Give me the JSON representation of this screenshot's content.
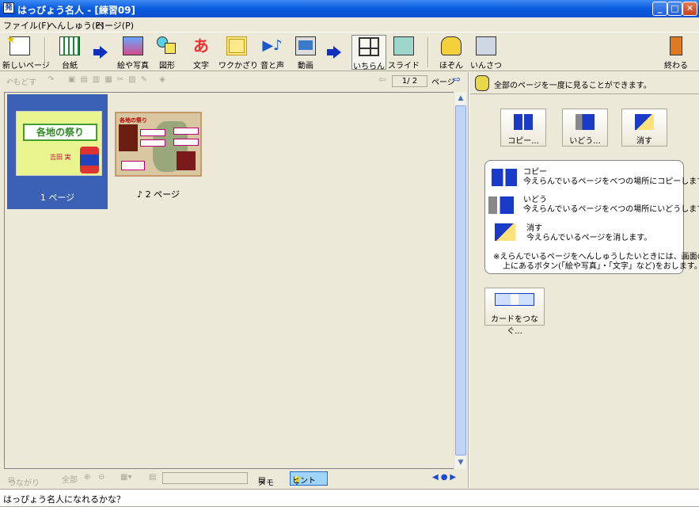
{
  "window": {
    "title": "はっぴょう名人 - [練習09]"
  },
  "menu": [
    "ファイル(F)",
    "へんしゅう(E)",
    "ページ(P)"
  ],
  "toolbar": {
    "new_page": "新しいページ",
    "base": "台紙",
    "picture": "絵や写真",
    "shape": "図形",
    "text": "文字",
    "frame": "ワクかざり",
    "sound": "音と声",
    "video": "動画",
    "list": "いちらん",
    "slide": "スライド",
    "save": "ほぞん",
    "print": "いんさつ",
    "exit": "終わる"
  },
  "subtoolbar": {
    "undo": "もどす",
    "page_indicator": "1/ 2",
    "page_label": "ページ"
  },
  "thumbnails": [
    {
      "caption": "1 ページ",
      "slide_title": "各地の祭り",
      "slide_sub": "吉田 実"
    },
    {
      "caption": "♪ 2 ページ",
      "slide_title": "各地の祭り"
    }
  ],
  "bottombar": {
    "link": "つながり",
    "all": "全部",
    "memo": "メモ",
    "hint": "ヒント"
  },
  "rightpane": {
    "header": "全部のページを一度に見ることができます。",
    "buttons": {
      "copy": "コピー...",
      "move": "いどう...",
      "delete": "消す"
    },
    "info": {
      "copy_title": "コピー",
      "copy_desc": "今えらんでいるページをべつの場所にコピーします。",
      "move_title": "いどう",
      "move_desc": "今えらんでいるページをべつの場所にいどうします。",
      "delete_title": "消す",
      "delete_desc": "今えらんでいるページを消します。",
      "note_line1": "※えらんでいるページをへんしゅうしたいときには、画面の",
      "note_line2": "上にあるボタン(「絵や写真」・「文字」など)をおします。"
    },
    "card_button": "カードをつなぐ..."
  },
  "status": "はっぴょう名人になれるかな？"
}
